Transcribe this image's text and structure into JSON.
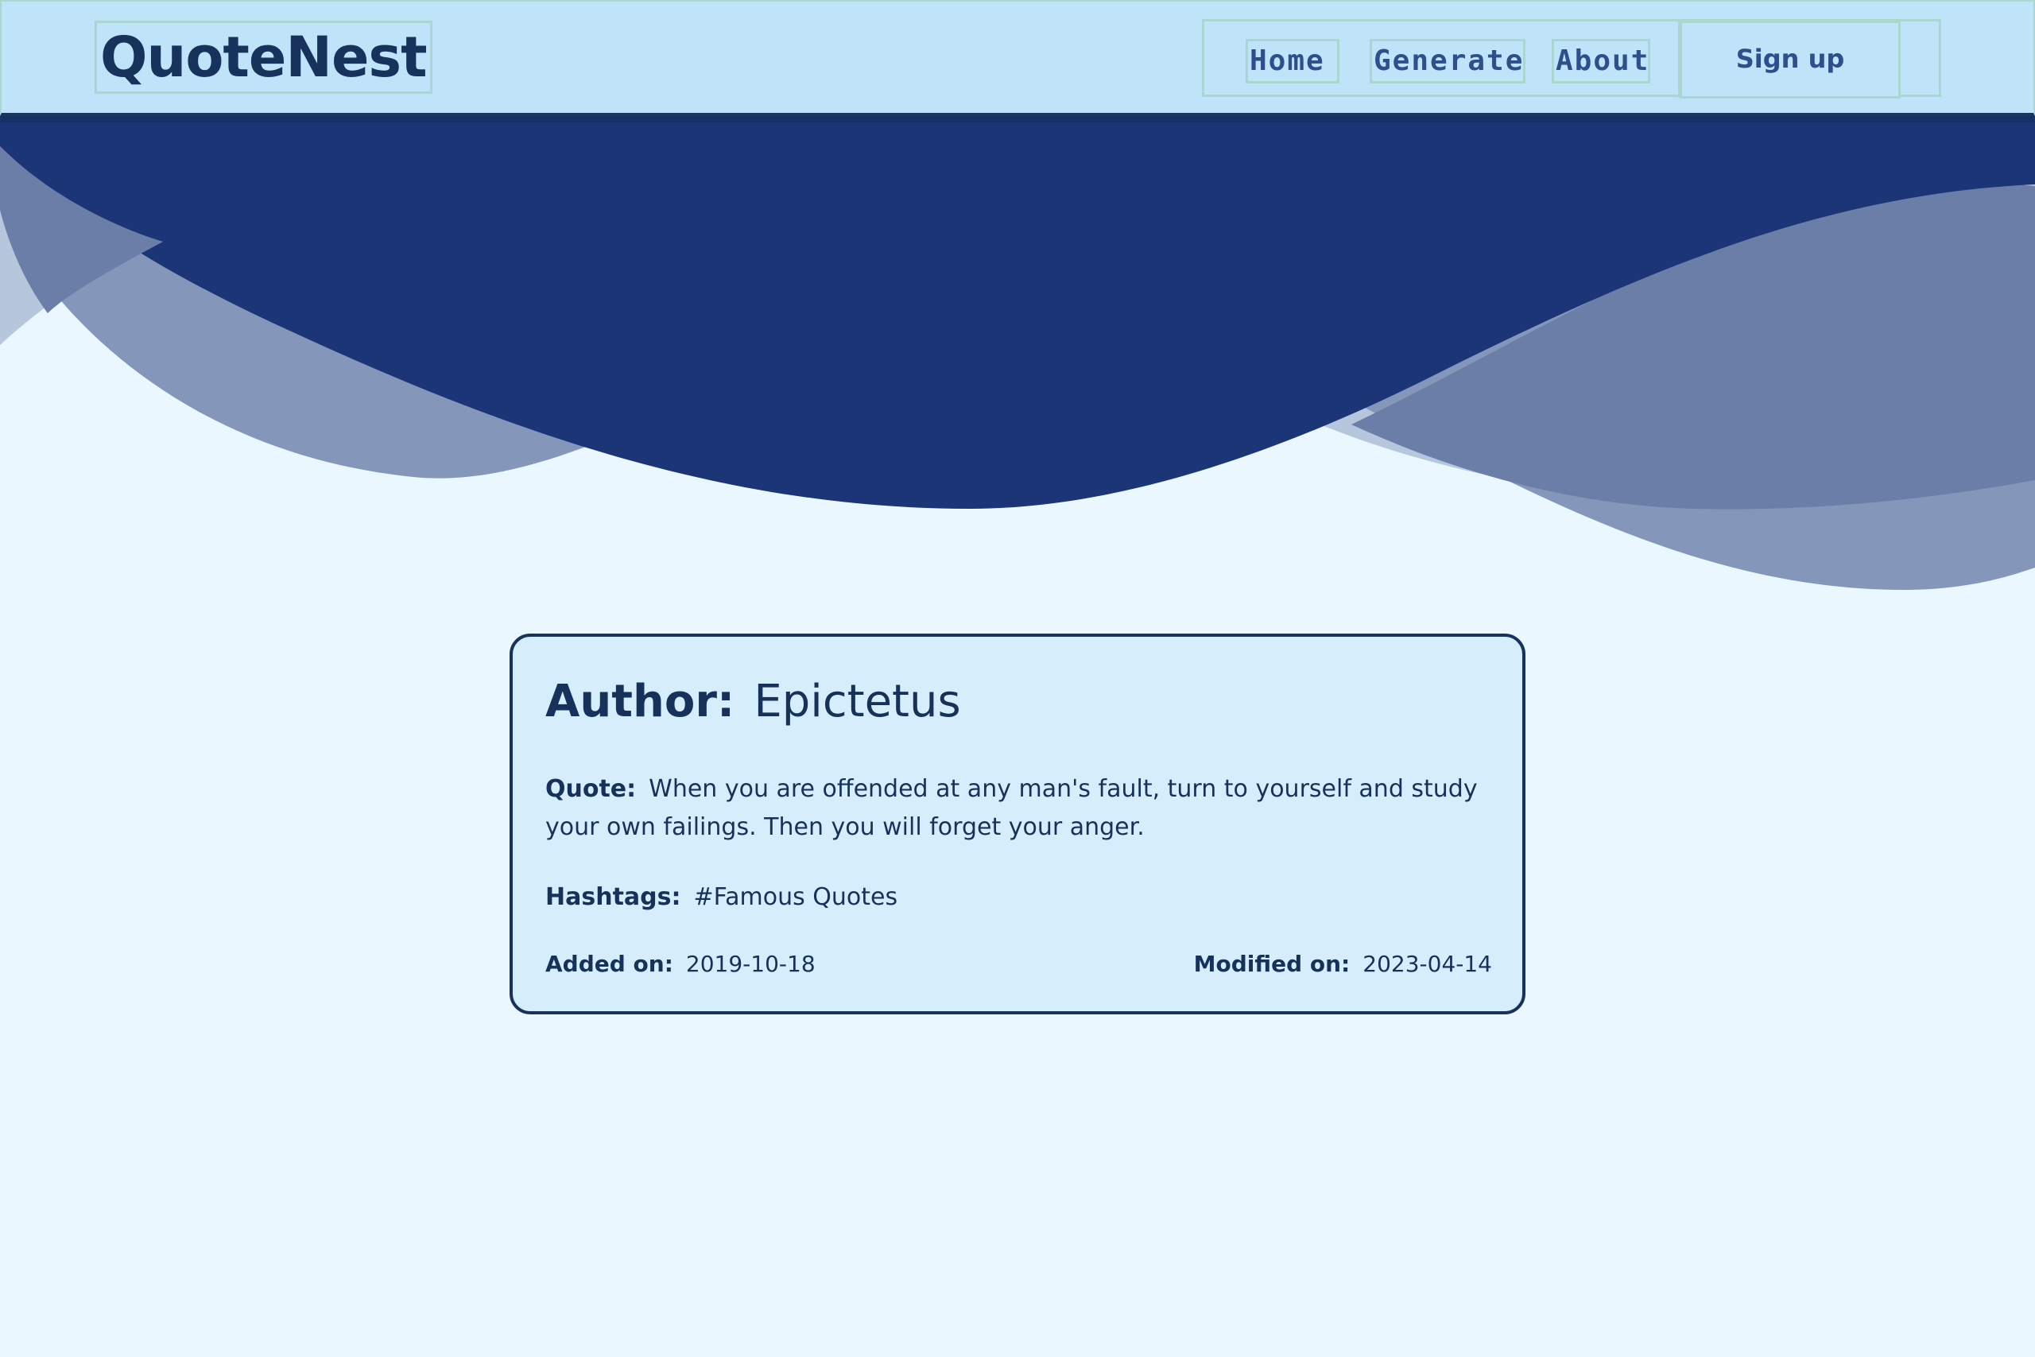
{
  "navbar": {
    "logo": "QuoteNest",
    "links": {
      "home": "Home",
      "generate": "Generate",
      "about": "About"
    },
    "signup_label": "Sign up"
  },
  "quote_card": {
    "author_label": "Author:",
    "author": "Epictetus",
    "quote_label": "Quote:",
    "quote": "When you are offended at any man's fault, turn to yourself and study your own failings. Then you will forget your anger.",
    "hashtags_label": "Hashtags:",
    "hashtags": "#Famous Quotes",
    "added_label": "Added on:",
    "added_date": "2019-10-18",
    "modified_label": "Modified on:",
    "modified_date": "2023-04-14"
  },
  "colors": {
    "navbar_bg": "#bfe3f8",
    "page_bg": "#eaf7fe",
    "wave_dark": "#1b3577",
    "wave_mid": "#6a7ea8",
    "wave_light": "#b6c7dd",
    "card_bg": "#d6eefb",
    "text": "#17325a"
  }
}
